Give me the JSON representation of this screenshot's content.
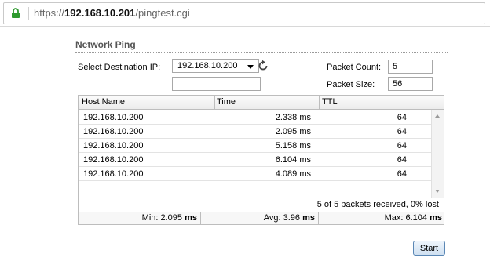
{
  "browser": {
    "url_prefix": "https://",
    "url_host": "192.168.10.201",
    "url_path": "/pingtest.cgi"
  },
  "panel": {
    "title": "Network Ping",
    "dest_label": "Select Destination IP:",
    "dest_value": "192.168.10.200",
    "dest_custom_value": "",
    "packet_count_label": "Packet Count:",
    "packet_count_value": "5",
    "packet_size_label": "Packet Size:",
    "packet_size_value": "56"
  },
  "table": {
    "headers": [
      "Host Name",
      "Time",
      "TTL"
    ],
    "rows": [
      {
        "host": "192.168.10.200",
        "time": "2.338 ms",
        "ttl": "64"
      },
      {
        "host": "192.168.10.200",
        "time": "2.095 ms",
        "ttl": "64"
      },
      {
        "host": "192.168.10.200",
        "time": "5.158 ms",
        "ttl": "64"
      },
      {
        "host": "192.168.10.200",
        "time": "6.104 ms",
        "ttl": "64"
      },
      {
        "host": "192.168.10.200",
        "time": "4.089 ms",
        "ttl": "64"
      }
    ],
    "summary": "5 of 5 packets received, 0% lost",
    "min_label": "Min: 2.095",
    "avg_label": "Avg: 3.96",
    "max_label": "Max: 6.104",
    "unit": "ms"
  },
  "actions": {
    "start_label": "Start"
  },
  "colors": {
    "lock": "#2e9a2e",
    "button_border": "#5a87b5"
  },
  "icons": {
    "lock": "lock-icon",
    "refresh": "refresh-icon",
    "dropdown": "chevron-down-icon"
  }
}
